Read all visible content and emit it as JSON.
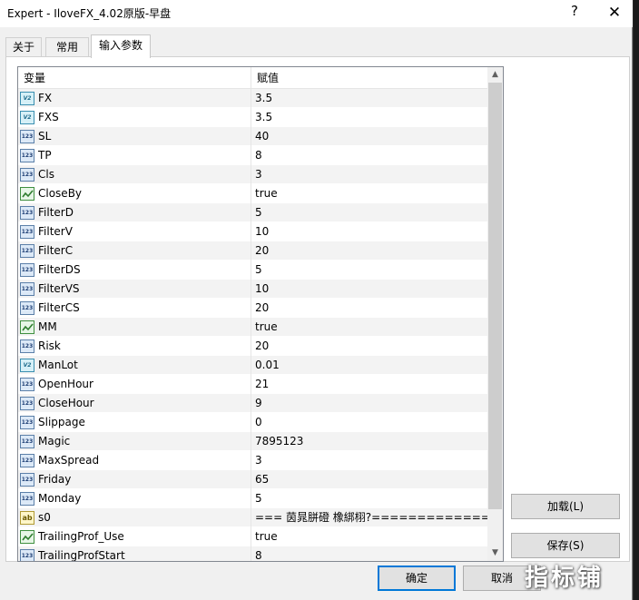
{
  "window": {
    "title": "Expert - IloveFX_4.02原版-早盘",
    "help_glyph": "?",
    "close_glyph": "✕"
  },
  "tabs": [
    {
      "label": "关于",
      "active": false
    },
    {
      "label": "常用",
      "active": false
    },
    {
      "label": "输入参数",
      "active": true
    }
  ],
  "grid": {
    "col_variable": "变量",
    "col_value": "赋值",
    "rows": [
      {
        "name": "FX",
        "value": "3.5",
        "type": "double"
      },
      {
        "name": "FXS",
        "value": "3.5",
        "type": "double"
      },
      {
        "name": "SL",
        "value": "40",
        "type": "int"
      },
      {
        "name": "TP",
        "value": "8",
        "type": "int"
      },
      {
        "name": "Cls",
        "value": "3",
        "type": "int"
      },
      {
        "name": "CloseBy",
        "value": "true",
        "type": "bool"
      },
      {
        "name": "FilterD",
        "value": "5",
        "type": "int"
      },
      {
        "name": "FilterV",
        "value": "10",
        "type": "int"
      },
      {
        "name": "FilterC",
        "value": "20",
        "type": "int"
      },
      {
        "name": "FilterDS",
        "value": "5",
        "type": "int"
      },
      {
        "name": "FilterVS",
        "value": "10",
        "type": "int"
      },
      {
        "name": "FilterCS",
        "value": "20",
        "type": "int"
      },
      {
        "name": "MM",
        "value": "true",
        "type": "bool"
      },
      {
        "name": "Risk",
        "value": "20",
        "type": "int"
      },
      {
        "name": "ManLot",
        "value": "0.01",
        "type": "double"
      },
      {
        "name": "OpenHour",
        "value": "21",
        "type": "int"
      },
      {
        "name": "CloseHour",
        "value": "9",
        "type": "int"
      },
      {
        "name": "Slippage",
        "value": "0",
        "type": "int"
      },
      {
        "name": "Magic",
        "value": "7895123",
        "type": "int"
      },
      {
        "name": "MaxSpread",
        "value": "3",
        "type": "int"
      },
      {
        "name": "Friday",
        "value": "65",
        "type": "int"
      },
      {
        "name": "Monday",
        "value": "5",
        "type": "int"
      },
      {
        "name": "s0",
        "value": "=== 茵晁胼磴 橡綁栩?==============...",
        "type": "string"
      },
      {
        "name": "TrailingProf_Use",
        "value": "true",
        "type": "bool"
      },
      {
        "name": "TrailingProfStart",
        "value": "8",
        "type": "int"
      }
    ]
  },
  "icon_text": {
    "int": "123",
    "double": "V2",
    "string": "ab"
  },
  "scrollbar": {
    "up": "▲",
    "down": "▼"
  },
  "buttons": {
    "load": "加载(L)",
    "save": "保存(S)",
    "ok": "确定",
    "cancel": "取消"
  },
  "watermark": "指标铺"
}
